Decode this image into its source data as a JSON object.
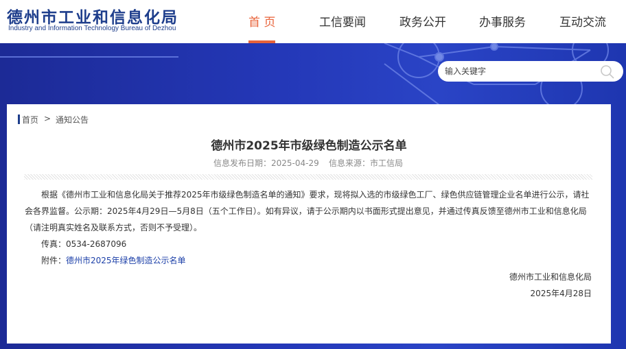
{
  "logo": {
    "title_cn": "德州市工业和信息化局",
    "title_en": "Industry and Information Technology Bureau of Dezhou"
  },
  "nav": {
    "items": [
      {
        "label": "首 页"
      },
      {
        "label": "工信要闻"
      },
      {
        "label": "政务公开"
      },
      {
        "label": "办事服务"
      },
      {
        "label": "互动交流"
      }
    ],
    "active_index": 0
  },
  "search": {
    "placeholder": "输入关键字",
    "icon": "search-icon"
  },
  "breadcrumb": {
    "home": "首页",
    "separator": ">",
    "current": "通知公告"
  },
  "article": {
    "title": "德州市2025年市级绿色制造公示名单",
    "publish_label": "信息发布日期：2025-04-29",
    "source_label": "信息来源：市工信局",
    "paragraph_lines": [
      "根据《德州市工业和信息化局关于推荐2025年市级绿色制造名单的通知》要求，现将拟入选的市级绿色工厂、绿色供应链管理企业名单进行公示，请社",
      "会各界监督。公示期：2025年4月29日—5月8日（五个工作日）。如有异议，请于公示期内以书面形式提出意见，并通过传真反馈至德州市工业和信息化局",
      "（请注明真实姓名及联系方式，否则不予受理）。"
    ],
    "fax": "传真：0534-2687096",
    "attachment_label": "附件：",
    "attachment_link": "德州市2025年绿色制造公示名单",
    "signature": "德州市工业和信息化局",
    "date": "2025年4月28日"
  },
  "colors": {
    "brand": "#1e3e8c",
    "accent": "#e8633a",
    "banner": "#2438b8",
    "link": "#1b3fa8"
  }
}
